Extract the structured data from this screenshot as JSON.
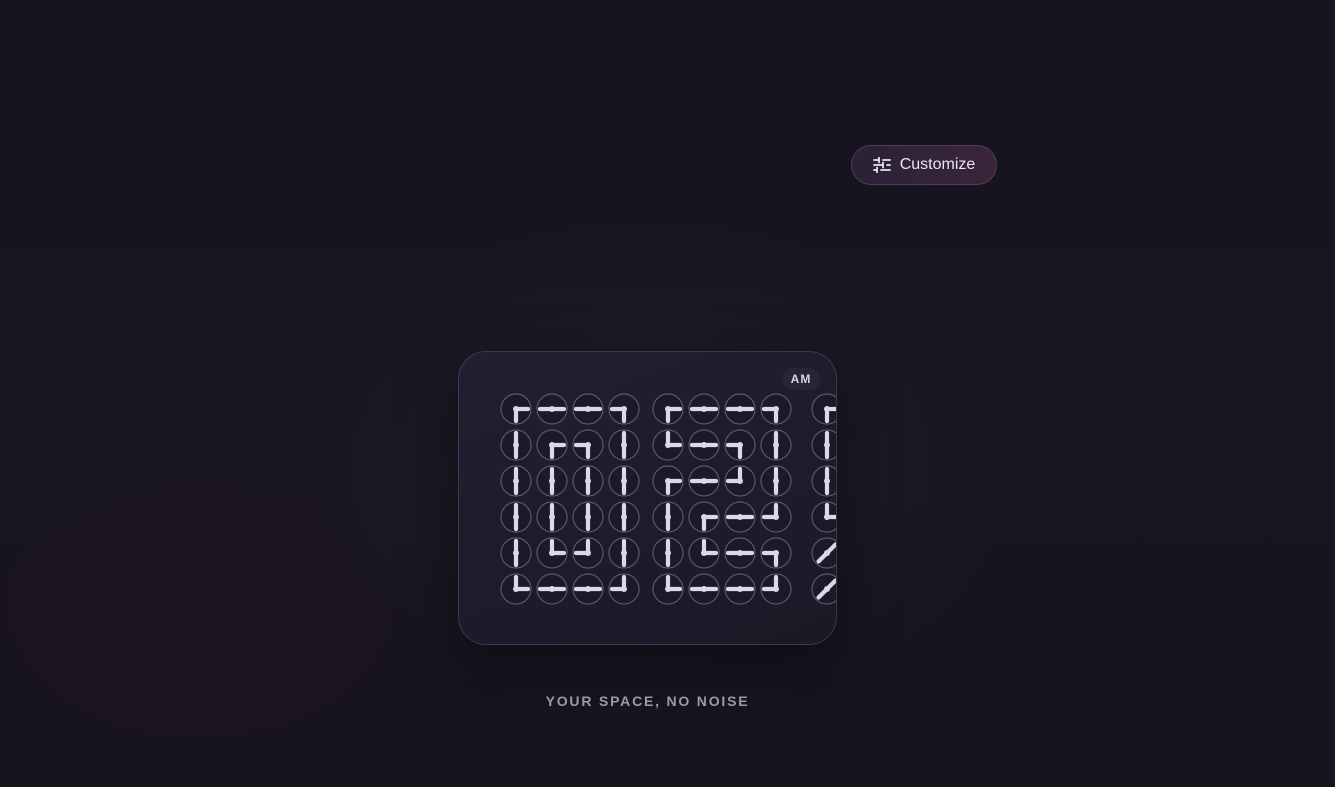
{
  "toolbar": {
    "customize_label": "Customize",
    "customize_icon": "sliders-icon"
  },
  "clock": {
    "period": "AM",
    "dial_shape": "circle",
    "hand_color": "#dcd8ec",
    "ring_color": "#5a5670",
    "dial_fill": "#1c1a27",
    "digits": [
      {
        "glyph": "0",
        "rows": [
          [
            [
              "e",
              "s"
            ],
            [
              "e",
              "w"
            ],
            [
              "e",
              "w"
            ],
            [
              "w",
              "s"
            ]
          ],
          [
            [
              "n",
              "s"
            ],
            [
              "e",
              "s"
            ],
            [
              "w",
              "s"
            ],
            [
              "n",
              "s"
            ]
          ],
          [
            [
              "n",
              "s"
            ],
            [
              "n",
              "s"
            ],
            [
              "n",
              "s"
            ],
            [
              "n",
              "s"
            ]
          ],
          [
            [
              "n",
              "s"
            ],
            [
              "n",
              "s"
            ],
            [
              "n",
              "s"
            ],
            [
              "n",
              "s"
            ]
          ],
          [
            [
              "n",
              "s"
            ],
            [
              "n",
              "e"
            ],
            [
              "n",
              "w"
            ],
            [
              "n",
              "s"
            ]
          ],
          [
            [
              "n",
              "e"
            ],
            [
              "e",
              "w"
            ],
            [
              "e",
              "w"
            ],
            [
              "n",
              "w"
            ]
          ]
        ]
      },
      {
        "glyph": "5",
        "rows": [
          [
            [
              "e",
              "s"
            ],
            [
              "e",
              "w"
            ],
            [
              "e",
              "w"
            ],
            [
              "w",
              "s"
            ]
          ],
          [
            [
              "n",
              "e"
            ],
            [
              "e",
              "w"
            ],
            [
              "w",
              "s"
            ],
            [
              "n",
              "s"
            ]
          ],
          [
            [
              "e",
              "s"
            ],
            [
              "e",
              "w"
            ],
            [
              "n",
              "w"
            ],
            [
              "n",
              "s"
            ]
          ],
          [
            [
              "n",
              "s"
            ],
            [
              "e",
              "s"
            ],
            [
              "e",
              "w"
            ],
            [
              "n",
              "w"
            ]
          ],
          [
            [
              "n",
              "s"
            ],
            [
              "n",
              "e"
            ],
            [
              "e",
              "w"
            ],
            [
              "w",
              "s"
            ]
          ],
          [
            [
              "n",
              "e"
            ],
            [
              "e",
              "w"
            ],
            [
              "e",
              "w"
            ],
            [
              "n",
              "w"
            ]
          ]
        ]
      },
      {
        "glyph": "partial",
        "rows": [
          [
            [
              "e",
              "s"
            ]
          ],
          [
            [
              "n",
              "s"
            ]
          ],
          [
            [
              "n",
              "s"
            ]
          ],
          [
            [
              "n",
              "e"
            ]
          ],
          [
            [
              "sw",
              "ne"
            ]
          ],
          [
            [
              "sw",
              "ne"
            ]
          ]
        ]
      }
    ]
  },
  "tagline": "YOUR SPACE, NO NOISE",
  "colors": {
    "background": "#16141d",
    "card": "#201d2d",
    "button_start": "#2a2237",
    "button_end": "#3a2439"
  }
}
